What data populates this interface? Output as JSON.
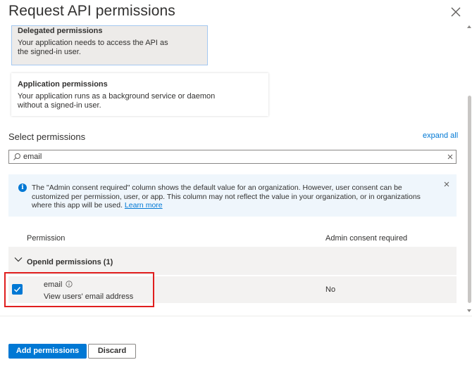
{
  "dialog": {
    "title": "Request API permissions"
  },
  "permission_types": [
    {
      "title": "Delegated permissions",
      "description": "Your application needs to access the API as the signed-in user.",
      "selected": true
    },
    {
      "title": "Application permissions",
      "description": "Your application runs as a background service or daemon without a signed-in user.",
      "selected": false
    }
  ],
  "select_permissions": {
    "label": "Select permissions",
    "expand_all": "expand all",
    "search_value": "email"
  },
  "info_banner": {
    "text": "The \"Admin consent required\" column shows the default value for an organization. However, user consent can be customized per permission, user, or app. This column may not reflect the value in your organization, or in organizations where this app will be used.",
    "link": "Learn more"
  },
  "table": {
    "columns": [
      "Permission",
      "Admin consent required"
    ],
    "group": {
      "label": "OpenId permissions (1)",
      "expanded": true
    },
    "rows": [
      {
        "name": "email",
        "description": "View users' email address",
        "admin_consent": "No",
        "checked": true
      }
    ]
  },
  "footer": {
    "primary": "Add permissions",
    "secondary": "Discard"
  },
  "colors": {
    "accent": "#0078d4",
    "highlight_border": "#e01e1e"
  }
}
